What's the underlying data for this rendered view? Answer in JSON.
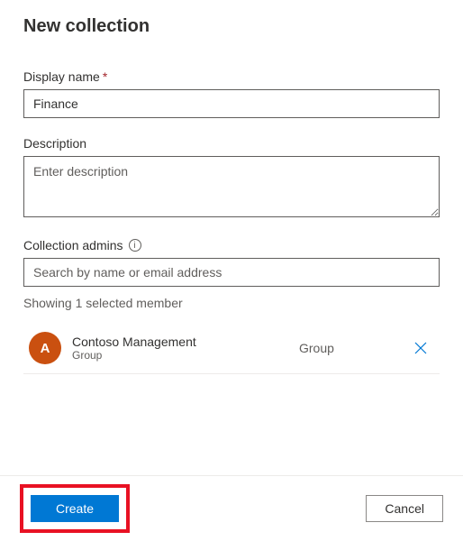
{
  "page_title": "New collection",
  "displayName": {
    "label": "Display name",
    "required_marker": "*",
    "value": "Finance"
  },
  "description": {
    "label": "Description",
    "placeholder": "Enter description"
  },
  "collectionAdmins": {
    "label": "Collection admins",
    "search_placeholder": "Search by name or email address",
    "selected_text": "Showing 1 selected member",
    "members": [
      {
        "avatar_initial": "A",
        "name": "Contoso Management",
        "subtext": "Group",
        "type": "Group"
      }
    ]
  },
  "footer": {
    "create_label": "Create",
    "cancel_label": "Cancel"
  }
}
